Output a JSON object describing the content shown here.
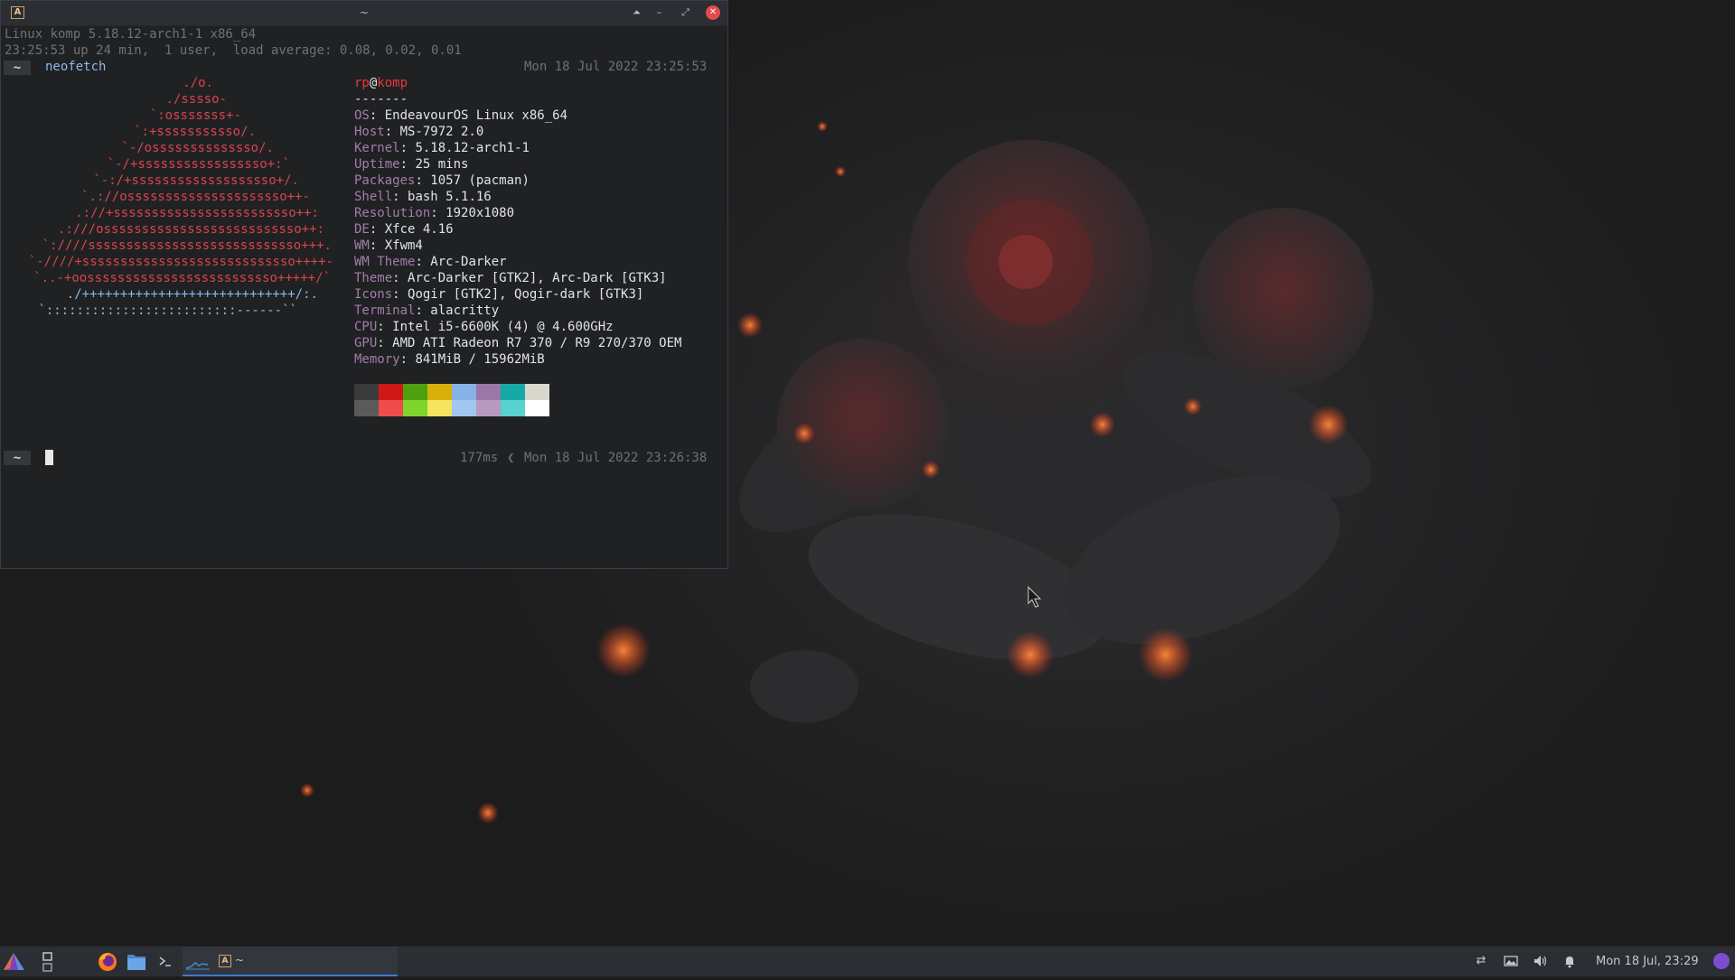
{
  "window": {
    "title": "~",
    "icon_name": "alacritty-icon",
    "controls": {
      "shade": "⏶",
      "minimize": "–",
      "maximize": "⤢",
      "close": "✕"
    }
  },
  "terminal": {
    "sysline1": "Linux komp 5.18.12-arch1-1 x86_64",
    "sysline2": "23:25:53 up 24 min,  1 user,  load average: 0.08, 0.02, 0.01",
    "prompt_symbol": "~",
    "command": "neofetch",
    "timestamp1": "Mon 18 Jul 2022 23:25:53",
    "ascii_logo": [
      {
        "r": "./o.",
        "b": ""
      },
      {
        "r": "./sssso-",
        "b": ""
      },
      {
        "r": "`:osssssss+-",
        "b": ""
      },
      {
        "r": "`:+sssssssssso/.",
        "b": ""
      },
      {
        "r": "`-/ossssssssssssso/.",
        "b": ""
      },
      {
        "r": "`-/+sssssssssssssssso+:`",
        "b": ""
      },
      {
        "r": "`-:/+sssssssssssssssssso+/.",
        "b": ""
      },
      {
        "r": "`.://osssssssssssssssssssso++-",
        "b": ""
      },
      {
        "r": ".://+ssssssssssssssssssssssso++:",
        "b": ""
      },
      {
        "r": ".:///ossssssssssssssssssssssssso++:",
        "b": ""
      },
      {
        "r": "`:////ssssssssssssssssssssssssssso+++.",
        "b": ""
      },
      {
        "r": "`-////+ssssssssssssssssssssssssssso++++-",
        "b": ""
      },
      {
        "r": "`..-+oosssssssssssssssssssssssso+++++/`",
        "b": ""
      },
      {
        "r": "",
        "b": "./++++++++++++++++++++++++++++/:."
      },
      {
        "r": "",
        "b": "`:::::::::::::::::::::::::------``"
      }
    ],
    "user": "rp",
    "at": "@",
    "host": "komp",
    "separator": "-------",
    "info": [
      {
        "key": "OS",
        "value": "EndeavourOS Linux x86_64"
      },
      {
        "key": "Host",
        "value": "MS-7972 2.0"
      },
      {
        "key": "Kernel",
        "value": "5.18.12-arch1-1"
      },
      {
        "key": "Uptime",
        "value": "25 mins"
      },
      {
        "key": "Packages",
        "value": "1057 (pacman)"
      },
      {
        "key": "Shell",
        "value": "bash 5.1.16"
      },
      {
        "key": "Resolution",
        "value": "1920x1080"
      },
      {
        "key": "DE",
        "value": "Xfce 4.16"
      },
      {
        "key": "WM",
        "value": "Xfwm4"
      },
      {
        "key": "WM Theme",
        "value": "Arc-Darker"
      },
      {
        "key": "Theme",
        "value": "Arc-Darker [GTK2], Arc-Dark [GTK3]"
      },
      {
        "key": "Icons",
        "value": "Qogir [GTK2], Qogir-dark [GTK3]"
      },
      {
        "key": "Terminal",
        "value": "alacritty"
      },
      {
        "key": "CPU",
        "value": "Intel i5-6600K (4) @ 4.600GHz"
      },
      {
        "key": "GPU",
        "value": "AMD ATI Radeon R7 370 / R9 270/370 OEM"
      },
      {
        "key": "Memory",
        "value": "841MiB / 15962MiB"
      }
    ],
    "palette_top": [
      "#3b3b3b",
      "#d01818",
      "#4ea00c",
      "#d8b00c",
      "#88b2e6",
      "#9a77a6",
      "#17a9a6",
      "#d8d8cf"
    ],
    "palette_bottom": [
      "#5a5a5a",
      "#f04c4c",
      "#7ed62c",
      "#f6e35e",
      "#a3c6f0",
      "#b799be",
      "#56d2cf",
      "#ffffff"
    ],
    "duration": "177ms",
    "arrow": "❮",
    "timestamp2": "Mon 18 Jul 2022 23:26:38"
  },
  "taskbar": {
    "active_task_label": "~",
    "clock": "Mon 18 Jul, 23:29",
    "accent": "#3a7bd5"
  }
}
